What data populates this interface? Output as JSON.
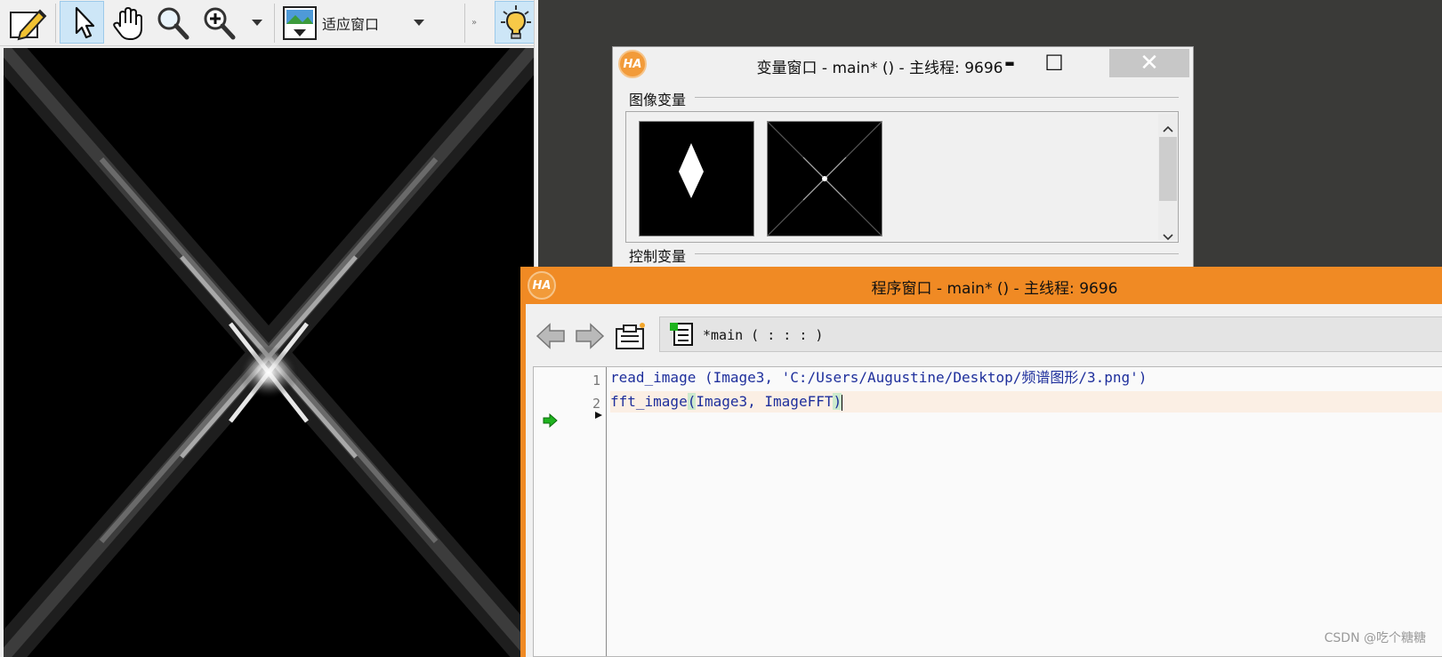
{
  "graphics_window": {
    "zoom_label": "适应窗口",
    "tools": [
      "edit-tool",
      "pointer-tool",
      "hand-tool",
      "magnifier-tool",
      "zoom-in-tool",
      "zoom-dropdown",
      "fit-window-tool",
      "help-hint-tool"
    ]
  },
  "variable_window": {
    "title": "变量窗口 - main* () - 主线程: 9696",
    "icon_text": "HA",
    "image_group_label": "图像变量",
    "control_group_label": "控制变量",
    "minimize_glyph": "▬",
    "maximize_glyph": "☐",
    "close_glyph": "✕"
  },
  "program_window": {
    "title": "程序窗口 - main* () - 主线程: 9696",
    "icon_text": "HA",
    "tab_label": "*main ( : : : )",
    "line_numbers": [
      "1",
      "2"
    ],
    "code": {
      "line1": "read_image (Image3, 'C:/Users/Augustine/Desktop/频谱图形/3.png')",
      "line2_fn": "fft_image",
      "line2_open": "(",
      "line2_args": "Image3, ImageFFT",
      "line2_close": ")"
    }
  },
  "watermark": "CSDN @吃个糖糖",
  "colors": {
    "program_title_bar": "#f08a24",
    "code_text": "#1e2f9c",
    "current_line": "#fbefe4",
    "canvas_bg": "#000000"
  }
}
